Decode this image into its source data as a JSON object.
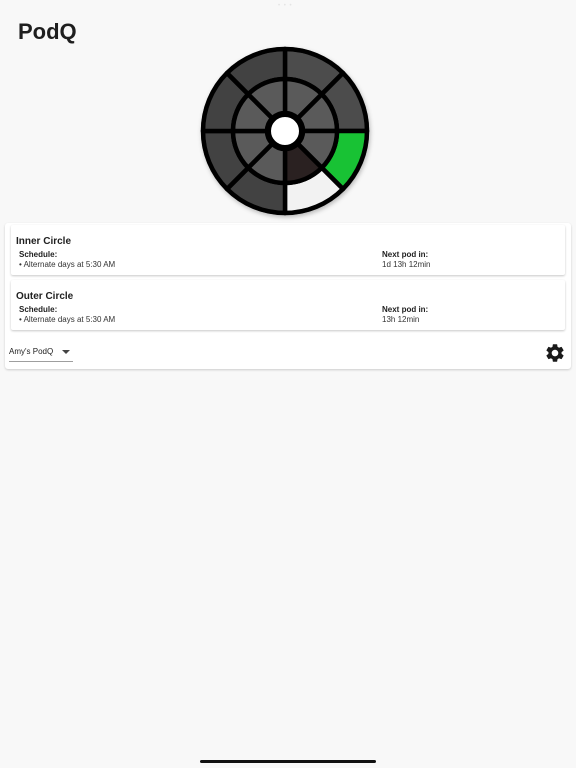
{
  "app": {
    "title": "PodQ"
  },
  "status_bar": {
    "dots": "• • •"
  },
  "wheel": {
    "colors": {
      "dark": "#4c4c4c",
      "darker": "#424242",
      "mid": "#5a5a5a",
      "inner_dark": "#2a2121",
      "active": "#18c234",
      "highlight": "#f2f2f2",
      "stroke": "#000000",
      "center": "#ffffff"
    },
    "outer_segments": [
      "dark",
      "dark",
      "active",
      "highlight",
      "darker",
      "darker",
      "darker",
      "darker"
    ],
    "inner_segments": [
      "mid",
      "mid",
      "mid",
      "inner_dark",
      "mid",
      "mid",
      "mid",
      "mid"
    ]
  },
  "circles": [
    {
      "name": "Inner Circle",
      "schedule_label": "Schedule:",
      "schedule_item": "• Alternate days at 5:30 AM",
      "next_label": "Next pod in:",
      "next_value": "1d 13h 12min"
    },
    {
      "name": "Outer Circle",
      "schedule_label": "Schedule:",
      "schedule_item": "• Alternate days at 5:30 AM",
      "next_label": "Next pod in:",
      "next_value": "13h 12min"
    }
  ],
  "pod_selector": {
    "selected": "Amy's PodQ"
  },
  "icons": {
    "settings": "gear-icon",
    "dropdown": "chevron-down-icon"
  }
}
